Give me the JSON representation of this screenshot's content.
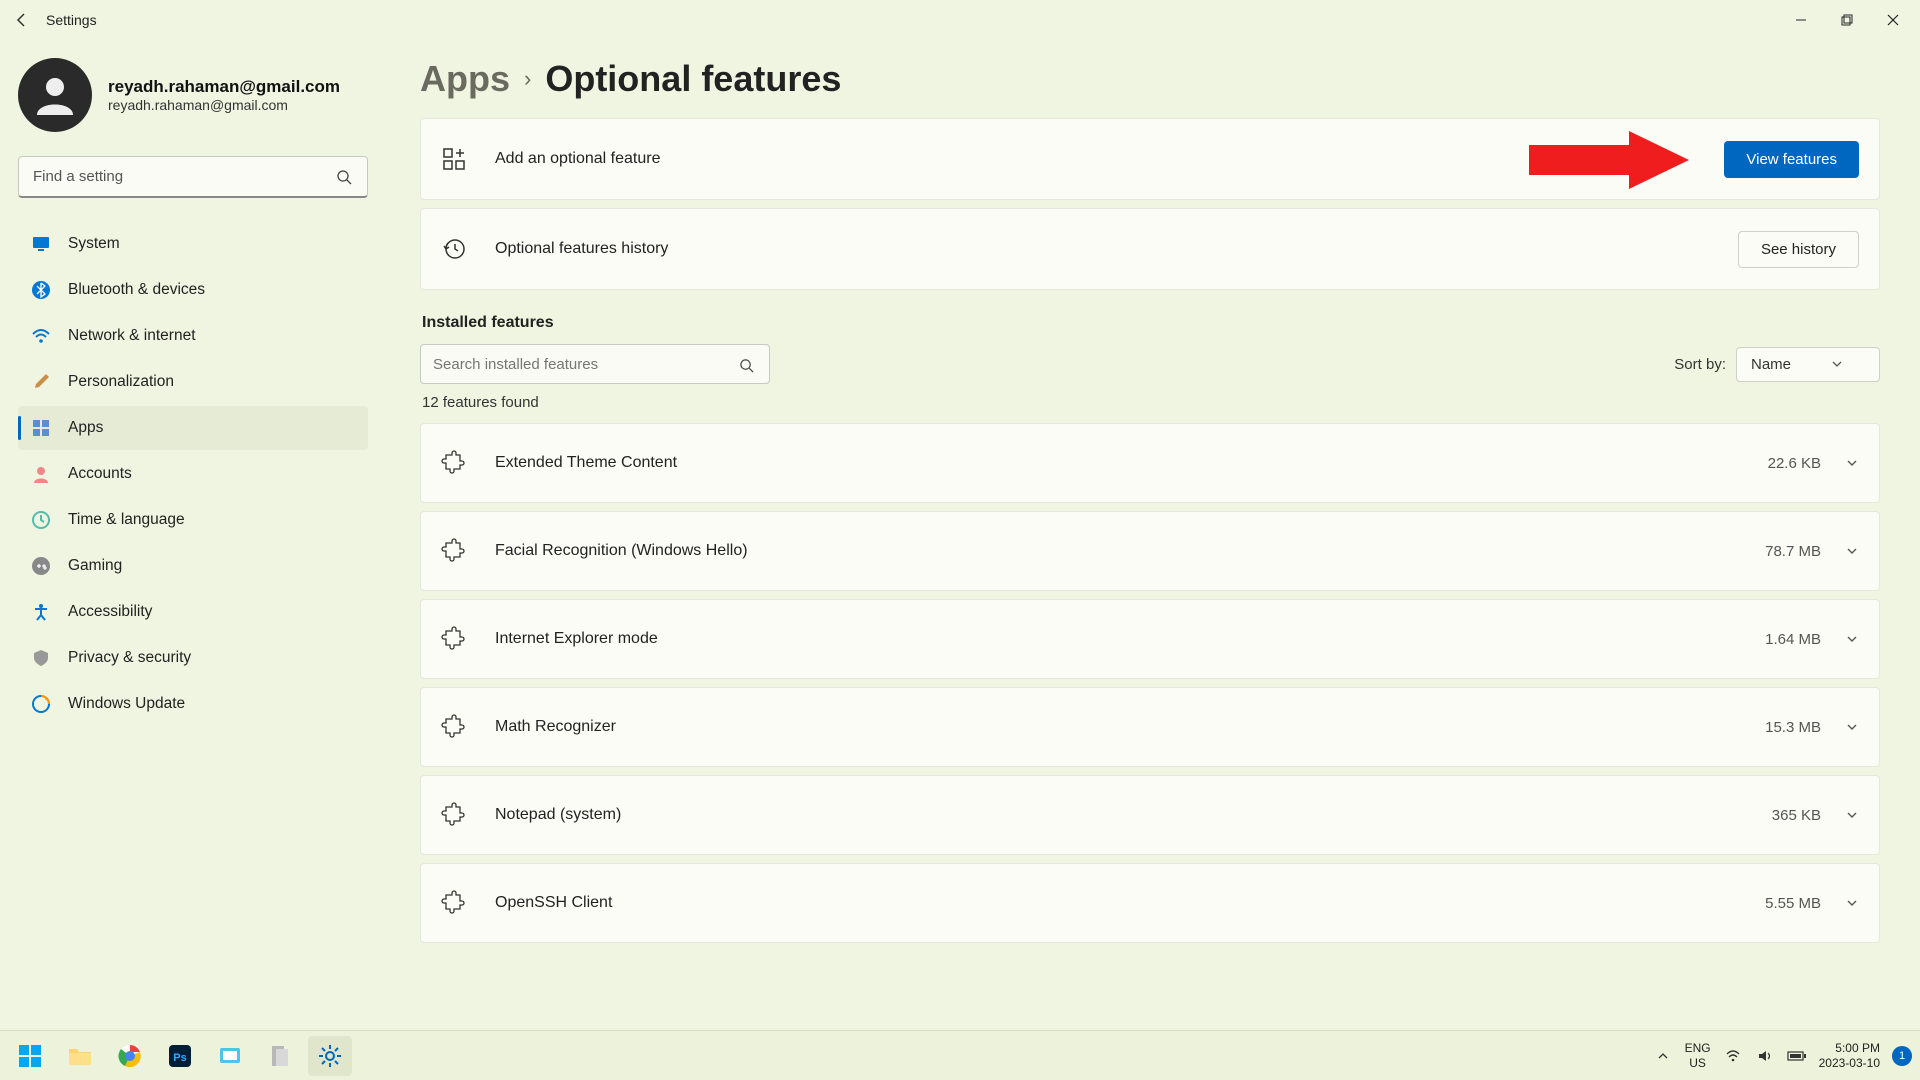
{
  "titlebar": {
    "title": "Settings"
  },
  "profile": {
    "email1": "reyadh.rahaman@gmail.com",
    "email2": "reyadh.rahaman@gmail.com"
  },
  "search": {
    "placeholder": "Find a setting"
  },
  "nav": {
    "items": [
      {
        "label": "System"
      },
      {
        "label": "Bluetooth & devices"
      },
      {
        "label": "Network & internet"
      },
      {
        "label": "Personalization"
      },
      {
        "label": "Apps"
      },
      {
        "label": "Accounts"
      },
      {
        "label": "Time & language"
      },
      {
        "label": "Gaming"
      },
      {
        "label": "Accessibility"
      },
      {
        "label": "Privacy & security"
      },
      {
        "label": "Windows Update"
      }
    ]
  },
  "breadcrumb": {
    "parent": "Apps",
    "current": "Optional features"
  },
  "cards": {
    "add": {
      "label": "Add an optional feature",
      "button": "View features"
    },
    "history": {
      "label": "Optional features history",
      "button": "See history"
    }
  },
  "section": {
    "title": "Installed features",
    "search_placeholder": "Search installed features",
    "sort_label": "Sort by:",
    "sort_value": "Name",
    "found": "12 features found"
  },
  "features": [
    {
      "name": "Extended Theme Content",
      "size": "22.6 KB"
    },
    {
      "name": "Facial Recognition (Windows Hello)",
      "size": "78.7 MB"
    },
    {
      "name": "Internet Explorer mode",
      "size": "1.64 MB"
    },
    {
      "name": "Math Recognizer",
      "size": "15.3 MB"
    },
    {
      "name": "Notepad (system)",
      "size": "365 KB"
    },
    {
      "name": "OpenSSH Client",
      "size": "5.55 MB"
    }
  ],
  "taskbar": {
    "lang1": "ENG",
    "lang2": "US",
    "time": "5:00 PM",
    "date": "2023-03-10",
    "badge": "1"
  }
}
